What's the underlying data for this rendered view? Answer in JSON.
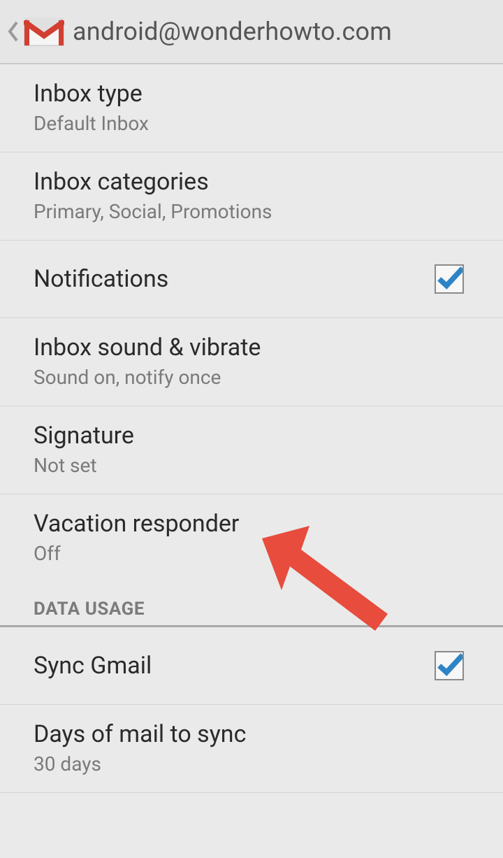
{
  "header": {
    "title": "android@wonderhowto.com"
  },
  "settings": [
    {
      "title": "Inbox type",
      "subtitle": "Default Inbox"
    },
    {
      "title": "Inbox categories",
      "subtitle": "Primary, Social, Promotions"
    },
    {
      "title": "Notifications",
      "checked": true
    },
    {
      "title": "Inbox sound & vibrate",
      "subtitle": "Sound on, notify once"
    },
    {
      "title": "Signature",
      "subtitle": "Not set"
    },
    {
      "title": "Vacation responder",
      "subtitle": "Off"
    }
  ],
  "section": {
    "data_usage_label": "DATA USAGE"
  },
  "data_usage": [
    {
      "title": "Sync Gmail",
      "checked": true
    },
    {
      "title": "Days of mail to sync",
      "subtitle": "30 days"
    }
  ],
  "annotation": {
    "arrow_color": "#e74c3c",
    "target": "vacation-responder"
  }
}
